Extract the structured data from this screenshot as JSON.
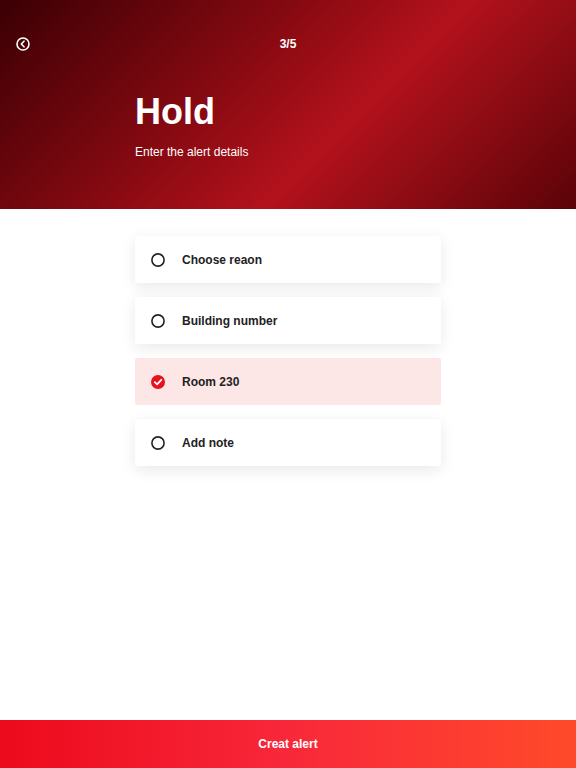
{
  "header": {
    "step": "3/5",
    "title": "Hold",
    "subtitle": "Enter the alert details"
  },
  "options": [
    {
      "label": "Choose reaon",
      "selected": false
    },
    {
      "label": "Building number",
      "selected": false
    },
    {
      "label": "Room 230",
      "selected": true
    },
    {
      "label": "Add note",
      "selected": false
    }
  ],
  "button": "Creat alert"
}
